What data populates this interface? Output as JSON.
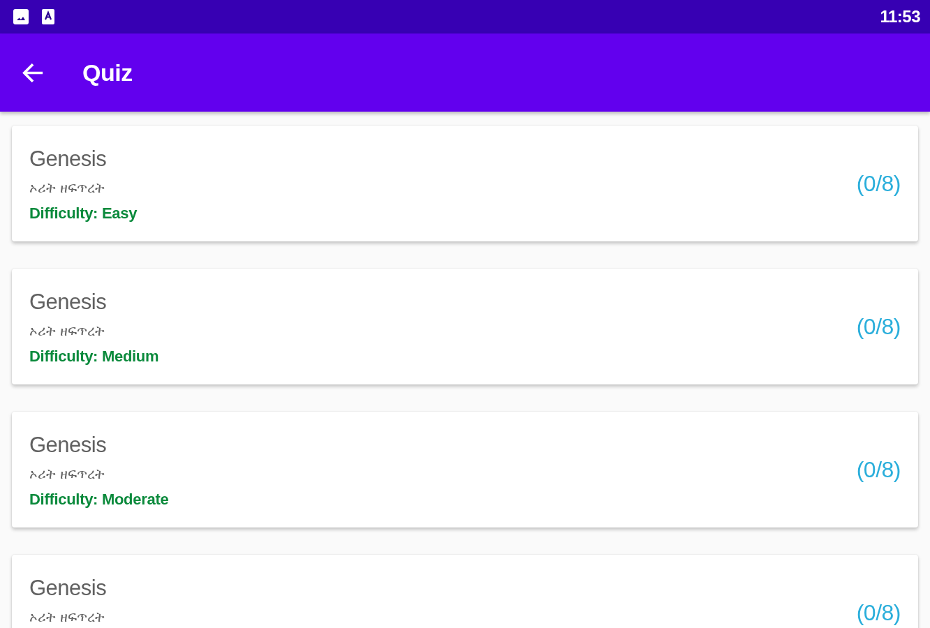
{
  "status_bar": {
    "time": "11:53"
  },
  "app_bar": {
    "title": "Quiz"
  },
  "quizzes": [
    {
      "title": "Genesis",
      "subtitle": "ኦሪት ዘፍጥረት",
      "difficulty": "Difficulty: Easy",
      "score": "(0/8)"
    },
    {
      "title": "Genesis",
      "subtitle": "ኦሪት ዘፍጥረት",
      "difficulty": "Difficulty: Medium",
      "score": "(0/8)"
    },
    {
      "title": "Genesis",
      "subtitle": "ኦሪት ዘፍጥረት",
      "difficulty": "Difficulty: Moderate",
      "score": "(0/8)"
    },
    {
      "title": "Genesis",
      "subtitle": "ኦሪት ዘፍጥረት",
      "score": "(0/8)"
    }
  ]
}
